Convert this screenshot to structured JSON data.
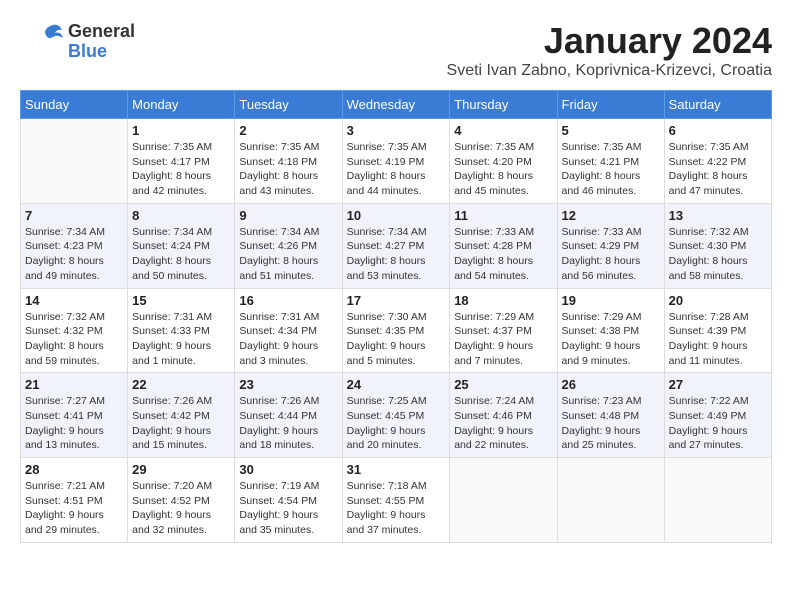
{
  "logo": {
    "general": "General",
    "blue": "Blue"
  },
  "title": "January 2024",
  "location": "Sveti Ivan Zabno, Koprivnica-Krizevci, Croatia",
  "days_of_week": [
    "Sunday",
    "Monday",
    "Tuesday",
    "Wednesday",
    "Thursday",
    "Friday",
    "Saturday"
  ],
  "weeks": [
    [
      {
        "day": "",
        "info": ""
      },
      {
        "day": "1",
        "info": "Sunrise: 7:35 AM\nSunset: 4:17 PM\nDaylight: 8 hours\nand 42 minutes."
      },
      {
        "day": "2",
        "info": "Sunrise: 7:35 AM\nSunset: 4:18 PM\nDaylight: 8 hours\nand 43 minutes."
      },
      {
        "day": "3",
        "info": "Sunrise: 7:35 AM\nSunset: 4:19 PM\nDaylight: 8 hours\nand 44 minutes."
      },
      {
        "day": "4",
        "info": "Sunrise: 7:35 AM\nSunset: 4:20 PM\nDaylight: 8 hours\nand 45 minutes."
      },
      {
        "day": "5",
        "info": "Sunrise: 7:35 AM\nSunset: 4:21 PM\nDaylight: 8 hours\nand 46 minutes."
      },
      {
        "day": "6",
        "info": "Sunrise: 7:35 AM\nSunset: 4:22 PM\nDaylight: 8 hours\nand 47 minutes."
      }
    ],
    [
      {
        "day": "7",
        "info": "Sunrise: 7:34 AM\nSunset: 4:23 PM\nDaylight: 8 hours\nand 49 minutes."
      },
      {
        "day": "8",
        "info": "Sunrise: 7:34 AM\nSunset: 4:24 PM\nDaylight: 8 hours\nand 50 minutes."
      },
      {
        "day": "9",
        "info": "Sunrise: 7:34 AM\nSunset: 4:26 PM\nDaylight: 8 hours\nand 51 minutes."
      },
      {
        "day": "10",
        "info": "Sunrise: 7:34 AM\nSunset: 4:27 PM\nDaylight: 8 hours\nand 53 minutes."
      },
      {
        "day": "11",
        "info": "Sunrise: 7:33 AM\nSunset: 4:28 PM\nDaylight: 8 hours\nand 54 minutes."
      },
      {
        "day": "12",
        "info": "Sunrise: 7:33 AM\nSunset: 4:29 PM\nDaylight: 8 hours\nand 56 minutes."
      },
      {
        "day": "13",
        "info": "Sunrise: 7:32 AM\nSunset: 4:30 PM\nDaylight: 8 hours\nand 58 minutes."
      }
    ],
    [
      {
        "day": "14",
        "info": "Sunrise: 7:32 AM\nSunset: 4:32 PM\nDaylight: 8 hours\nand 59 minutes."
      },
      {
        "day": "15",
        "info": "Sunrise: 7:31 AM\nSunset: 4:33 PM\nDaylight: 9 hours\nand 1 minute."
      },
      {
        "day": "16",
        "info": "Sunrise: 7:31 AM\nSunset: 4:34 PM\nDaylight: 9 hours\nand 3 minutes."
      },
      {
        "day": "17",
        "info": "Sunrise: 7:30 AM\nSunset: 4:35 PM\nDaylight: 9 hours\nand 5 minutes."
      },
      {
        "day": "18",
        "info": "Sunrise: 7:29 AM\nSunset: 4:37 PM\nDaylight: 9 hours\nand 7 minutes."
      },
      {
        "day": "19",
        "info": "Sunrise: 7:29 AM\nSunset: 4:38 PM\nDaylight: 9 hours\nand 9 minutes."
      },
      {
        "day": "20",
        "info": "Sunrise: 7:28 AM\nSunset: 4:39 PM\nDaylight: 9 hours\nand 11 minutes."
      }
    ],
    [
      {
        "day": "21",
        "info": "Sunrise: 7:27 AM\nSunset: 4:41 PM\nDaylight: 9 hours\nand 13 minutes."
      },
      {
        "day": "22",
        "info": "Sunrise: 7:26 AM\nSunset: 4:42 PM\nDaylight: 9 hours\nand 15 minutes."
      },
      {
        "day": "23",
        "info": "Sunrise: 7:26 AM\nSunset: 4:44 PM\nDaylight: 9 hours\nand 18 minutes."
      },
      {
        "day": "24",
        "info": "Sunrise: 7:25 AM\nSunset: 4:45 PM\nDaylight: 9 hours\nand 20 minutes."
      },
      {
        "day": "25",
        "info": "Sunrise: 7:24 AM\nSunset: 4:46 PM\nDaylight: 9 hours\nand 22 minutes."
      },
      {
        "day": "26",
        "info": "Sunrise: 7:23 AM\nSunset: 4:48 PM\nDaylight: 9 hours\nand 25 minutes."
      },
      {
        "day": "27",
        "info": "Sunrise: 7:22 AM\nSunset: 4:49 PM\nDaylight: 9 hours\nand 27 minutes."
      }
    ],
    [
      {
        "day": "28",
        "info": "Sunrise: 7:21 AM\nSunset: 4:51 PM\nDaylight: 9 hours\nand 29 minutes."
      },
      {
        "day": "29",
        "info": "Sunrise: 7:20 AM\nSunset: 4:52 PM\nDaylight: 9 hours\nand 32 minutes."
      },
      {
        "day": "30",
        "info": "Sunrise: 7:19 AM\nSunset: 4:54 PM\nDaylight: 9 hours\nand 35 minutes."
      },
      {
        "day": "31",
        "info": "Sunrise: 7:18 AM\nSunset: 4:55 PM\nDaylight: 9 hours\nand 37 minutes."
      },
      {
        "day": "",
        "info": ""
      },
      {
        "day": "",
        "info": ""
      },
      {
        "day": "",
        "info": ""
      }
    ]
  ]
}
